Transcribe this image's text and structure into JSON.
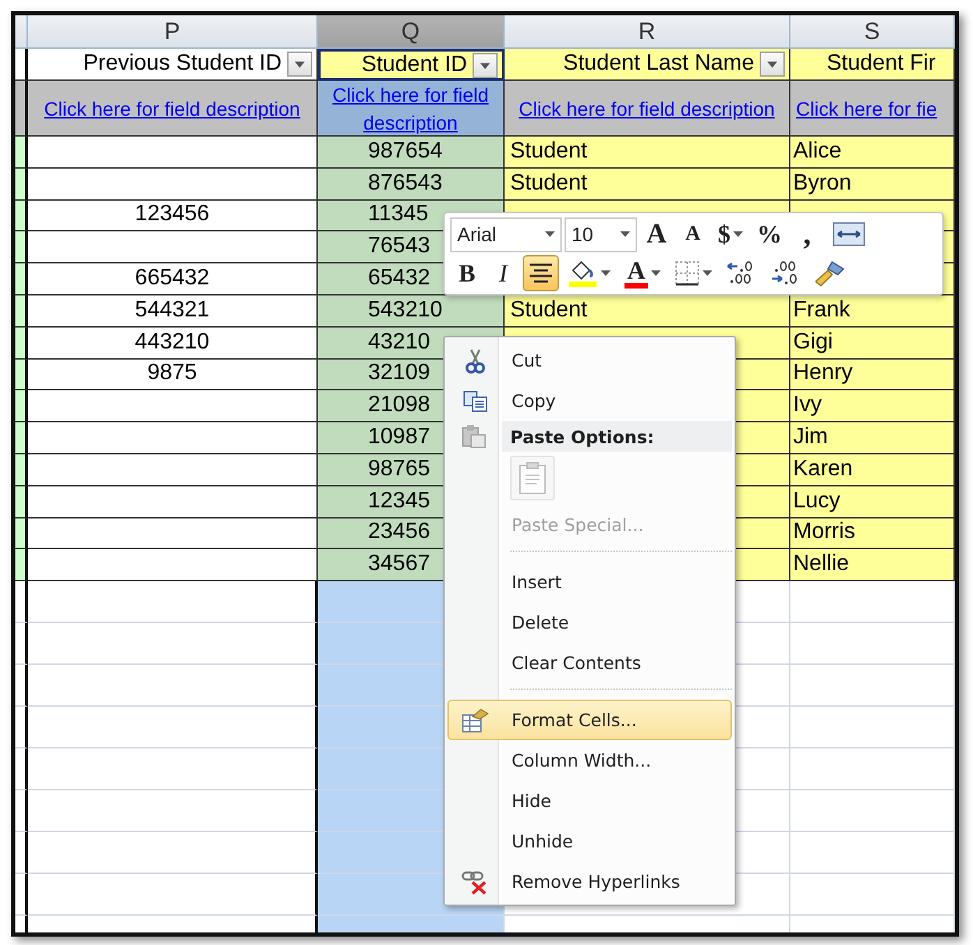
{
  "column_headers": [
    {
      "label": "P",
      "selected": false
    },
    {
      "label": "Q",
      "selected": true
    },
    {
      "label": "R",
      "selected": false
    },
    {
      "label": "S",
      "selected": false
    }
  ],
  "field_headers": [
    {
      "label": "Previous Student ID",
      "filter_button": true
    },
    {
      "label": "Student ID",
      "filter_button": true
    },
    {
      "label": "Student Last Name",
      "filter_button": true
    },
    {
      "label": "Student Fir",
      "filter_button": false
    }
  ],
  "description_links": [
    "Click here for field description",
    "Click here for field description",
    "Click here for field description",
    "Click here for fie"
  ],
  "rows": [
    {
      "student_id": "987654",
      "last_name": "Student",
      "first_name": "Alice"
    },
    {
      "student_id": "876543",
      "last_name": "Student",
      "first_name": "Byron"
    },
    {
      "previous_id": "123456",
      "student_id": "11345"
    },
    {
      "student_id": "76543"
    },
    {
      "previous_id": "665432",
      "student_id": "65432"
    },
    {
      "previous_id": "544321",
      "student_id": "543210",
      "last_name": "Student",
      "first_name": "Frank"
    },
    {
      "previous_id": "443210",
      "student_id": "43210",
      "first_name": "Gigi"
    },
    {
      "previous_id": "9875",
      "student_id": "32109",
      "first_name": "Henry"
    },
    {
      "student_id": "21098",
      "first_name": "Ivy"
    },
    {
      "student_id": "10987",
      "first_name": "Jim"
    },
    {
      "student_id": "98765",
      "first_name": "Karen"
    },
    {
      "student_id": "12345",
      "first_name": "Lucy"
    },
    {
      "student_id": "23456",
      "first_name": "Morris"
    },
    {
      "student_id": "34567",
      "first_name": "Nellie"
    }
  ],
  "mini_toolbar": {
    "row_1": [
      {
        "kind": "font_box",
        "text": "Arial"
      },
      {
        "kind": "size_box",
        "text": "10"
      },
      {
        "kind": "grow_font",
        "text": "A"
      },
      {
        "kind": "shrink_font",
        "text": "A"
      },
      {
        "kind": "currency",
        "text": "$"
      },
      {
        "kind": "percent",
        "text": "%"
      },
      {
        "kind": "comma",
        "text": ","
      },
      {
        "kind": "merge_center"
      }
    ],
    "row_2": [
      {
        "kind": "bold",
        "text": "B",
        "selected": false
      },
      {
        "kind": "italic",
        "text": "I",
        "selected": false
      },
      {
        "kind": "center",
        "selected": true
      },
      {
        "kind": "fill_color",
        "color": "#ffff00"
      },
      {
        "kind": "font_color",
        "text": "A",
        "color": "#ff0000"
      },
      {
        "kind": "borders"
      },
      {
        "kind": "increase_decimal"
      },
      {
        "kind": "decrease_decimal"
      },
      {
        "kind": "format_painter"
      }
    ]
  },
  "context_menu": {
    "items": [
      {
        "kind": "cut",
        "label": "Cut",
        "selected": false,
        "disabled": false
      },
      {
        "kind": "copy",
        "label": "Copy",
        "selected": false,
        "disabled": false
      },
      {
        "kind": "header",
        "label": "Paste Options:"
      },
      {
        "kind": "paste_options",
        "disabled": true
      },
      {
        "kind": "item",
        "label": "Paste Special...",
        "selected": false,
        "disabled": true
      },
      {
        "kind": "separator"
      },
      {
        "kind": "item",
        "label": "Insert",
        "selected": false,
        "disabled": false
      },
      {
        "kind": "item",
        "label": "Delete",
        "selected": false,
        "disabled": false
      },
      {
        "kind": "item",
        "label": "Clear Contents",
        "selected": false,
        "disabled": false
      },
      {
        "kind": "separator"
      },
      {
        "kind": "format_cells",
        "label": "Format Cells...",
        "selected": true,
        "disabled": false
      },
      {
        "kind": "item",
        "label": "Column Width...",
        "selected": false,
        "disabled": false
      },
      {
        "kind": "item",
        "label": "Hide",
        "selected": false,
        "disabled": false
      },
      {
        "kind": "item",
        "label": "Unhide",
        "selected": false,
        "disabled": false
      },
      {
        "kind": "remove_links",
        "label": "Remove Hyperlinks",
        "selected": false,
        "disabled": false
      }
    ]
  }
}
